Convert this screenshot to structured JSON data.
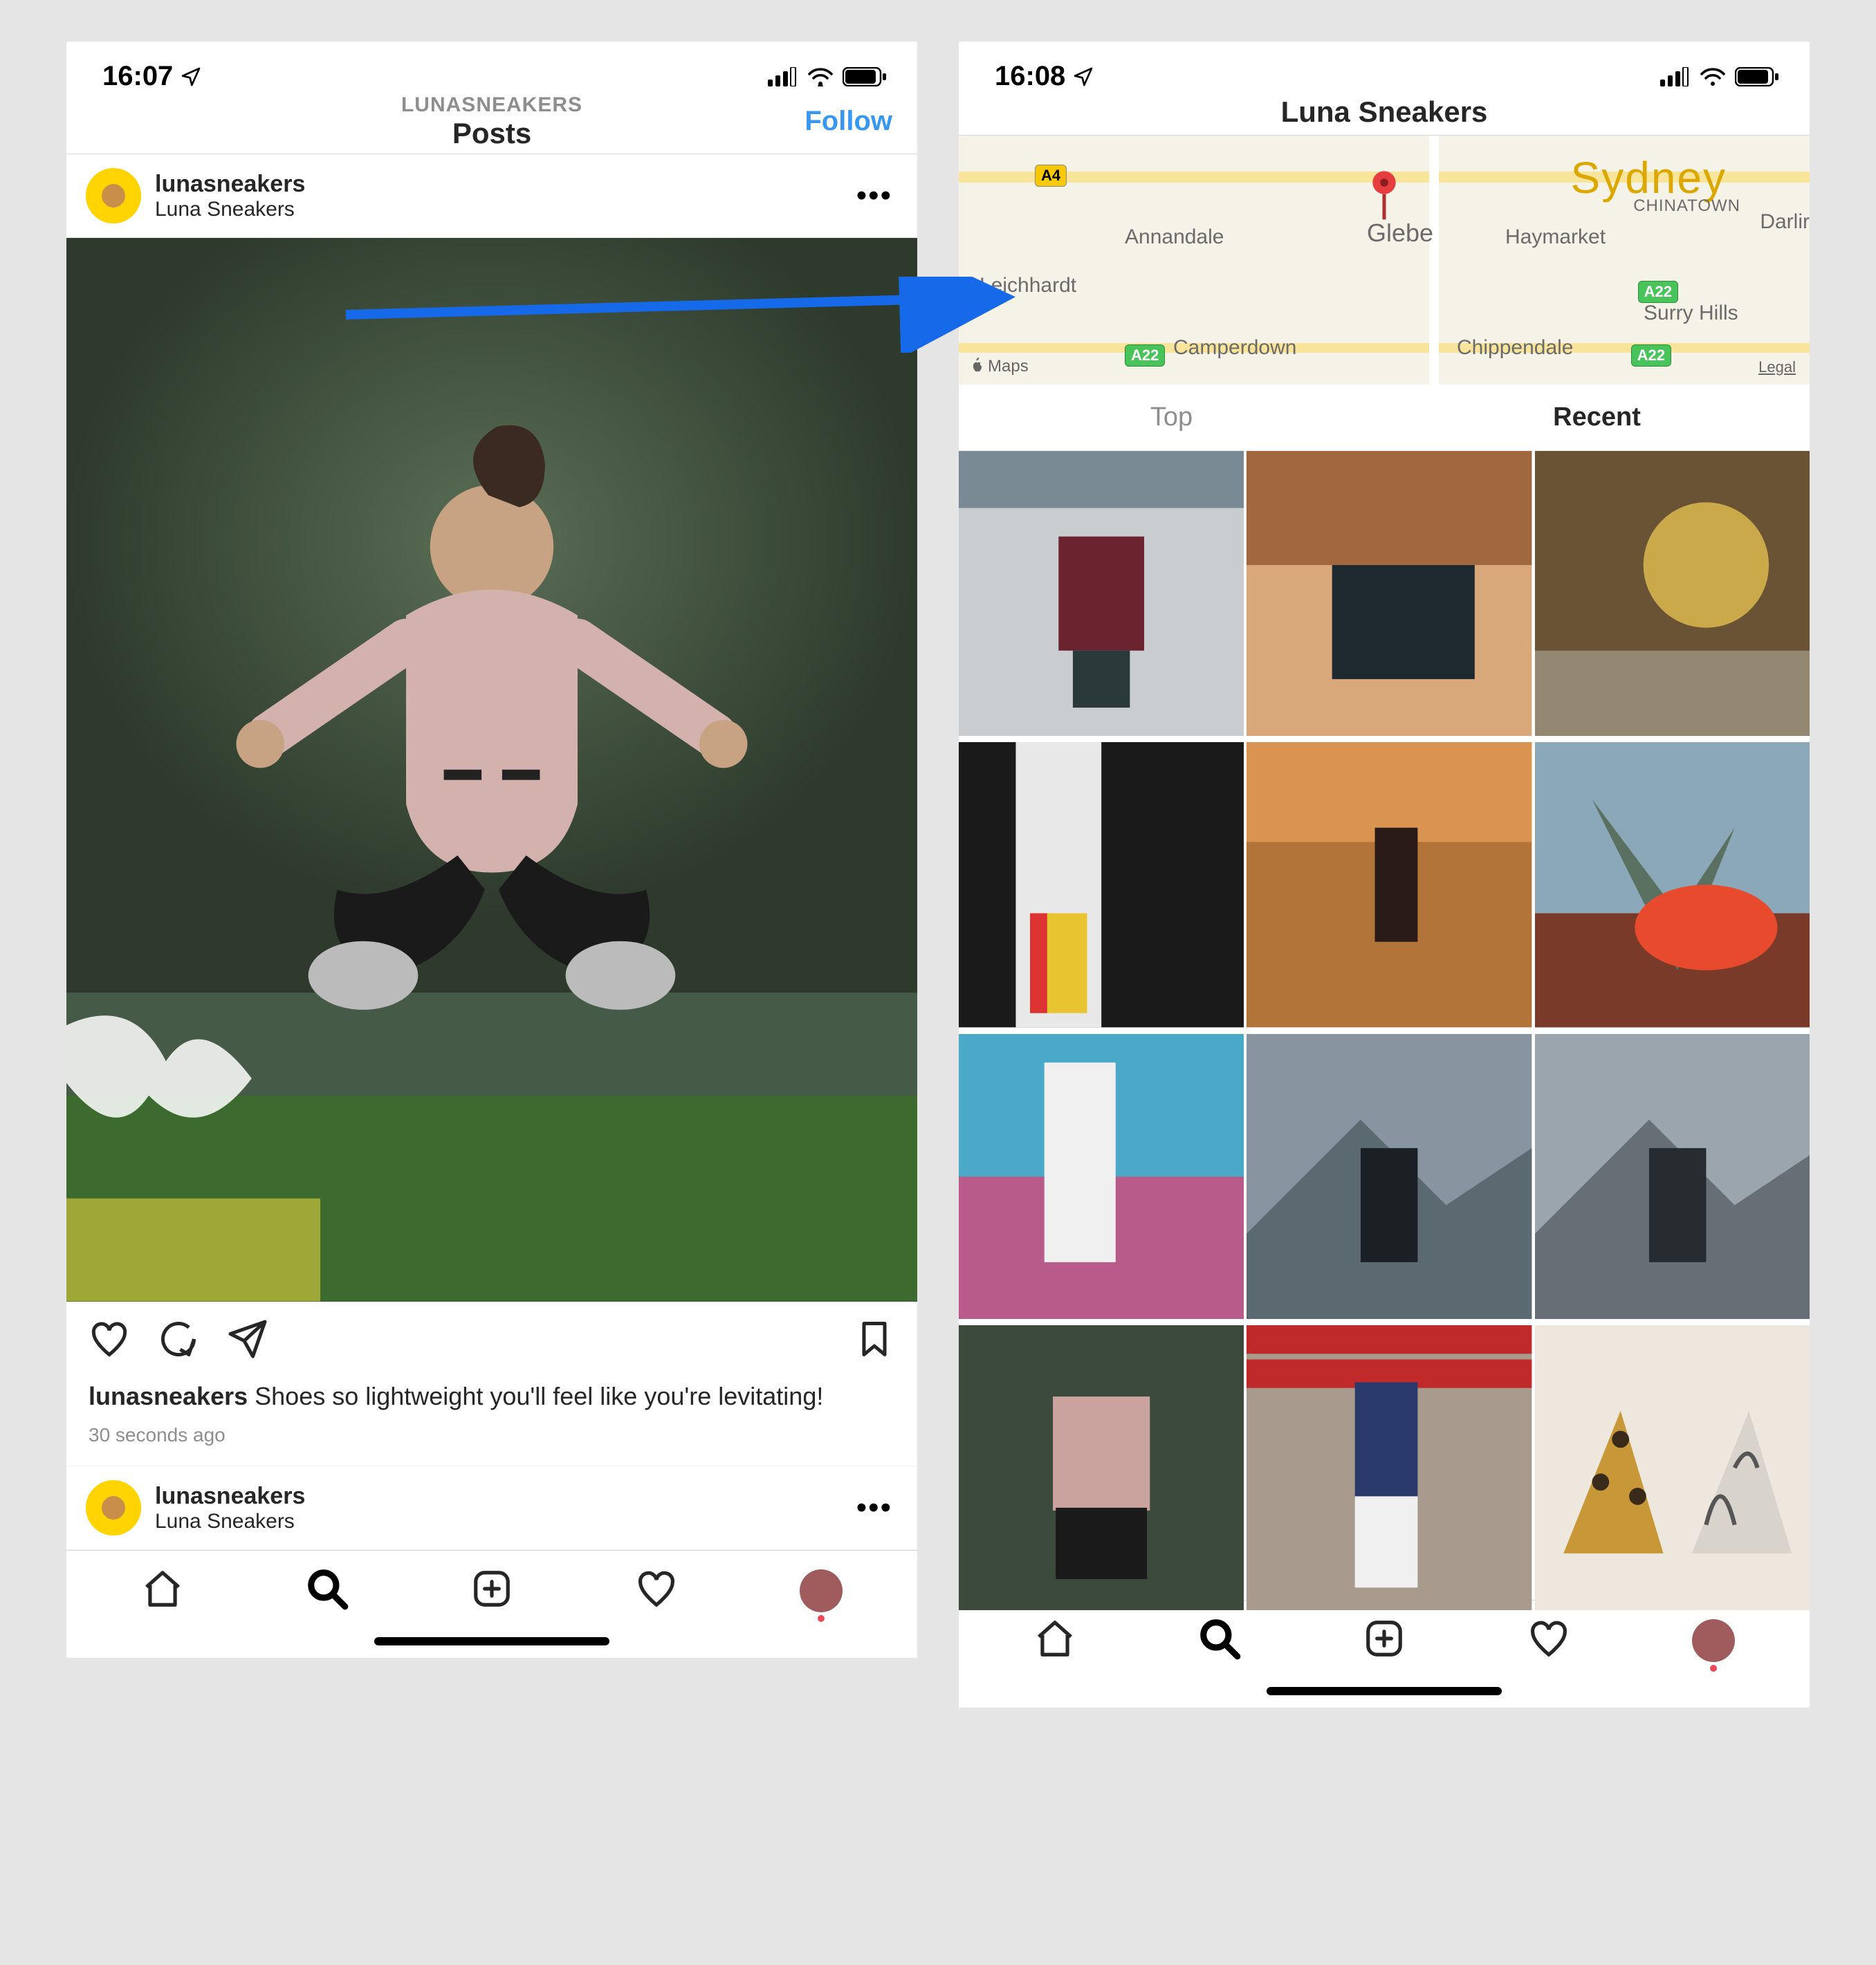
{
  "left": {
    "status": {
      "time": "16:07",
      "signal": "signal-4",
      "wifi": "wifi-3",
      "battery": "battery-85"
    },
    "nav": {
      "overline": "LUNASNEAKERS",
      "title": "Posts",
      "action": "Follow"
    },
    "post": {
      "username": "lunasneakers",
      "location": "Luna Sneakers",
      "caption_user": "lunasneakers",
      "caption_text": " Shoes so lightweight you'll feel like you're levitating!",
      "timestamp": "30 seconds ago"
    },
    "post2": {
      "username": "lunasneakers",
      "location": "Luna Sneakers"
    }
  },
  "right": {
    "status": {
      "time": "16:08"
    },
    "nav": {
      "title": "Luna Sneakers"
    },
    "map": {
      "labels": [
        "Sydney",
        "Glebe",
        "Annandale",
        "Haymarket",
        "Leichhardt",
        "Camperdown",
        "Chippendale",
        "Surry Hills",
        "CHINATOWN",
        "Darlir"
      ],
      "roads": [
        "A4",
        "A22",
        "A22",
        "A22"
      ],
      "attribution_text": "Maps",
      "legal": "Legal"
    },
    "tabs": {
      "top": "Top",
      "recent": "Recent",
      "active": "recent"
    },
    "grid_count": 12
  }
}
